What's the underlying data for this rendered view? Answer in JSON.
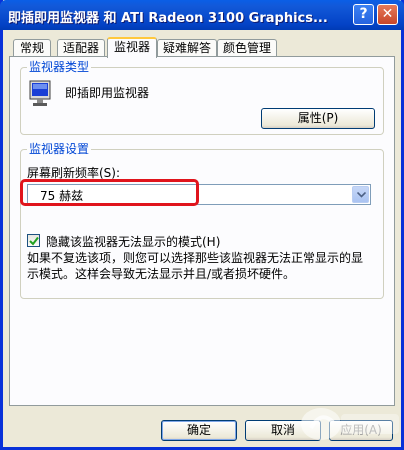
{
  "window": {
    "title": "即插即用监视器 和 ATI Radeon 3100 Graphics...",
    "help_glyph": "?",
    "close_glyph": "✕"
  },
  "tabs": [
    {
      "label": "常规"
    },
    {
      "label": "适配器"
    },
    {
      "label": "监视器",
      "active": true
    },
    {
      "label": "疑难解答"
    },
    {
      "label": "颜色管理"
    }
  ],
  "monitor_type": {
    "group_title": "监视器类型",
    "icon": "monitor-icon",
    "name": "即插即用监视器",
    "properties_button": "属性(P)"
  },
  "monitor_settings": {
    "group_title": "监视器设置",
    "refresh_label": "屏幕刷新频率(S):",
    "refresh_value": "75 赫兹",
    "hide_modes_label": "隐藏该监视器无法显示的模式(H)",
    "hide_modes_checked": true,
    "description": "如果不复选该项，则您可以选择那些该监视器无法正常显示的显示模式。这样会导致无法显示并且/或者损坏硬件。"
  },
  "buttons": {
    "ok": "确定",
    "cancel": "取消",
    "apply": "应用(A)"
  },
  "colors": {
    "accent": "#0046d5",
    "highlight": "#e0141c"
  }
}
